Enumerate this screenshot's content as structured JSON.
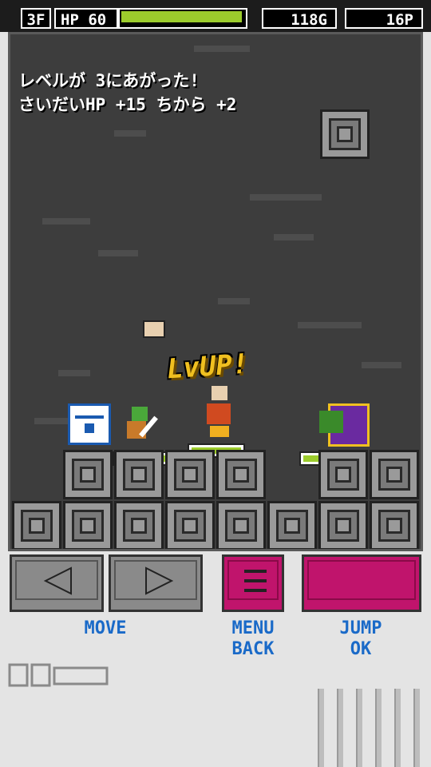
{
  "hud": {
    "floor": "3F",
    "hp_label": "HP",
    "hp_value": "60",
    "hp_fraction": 0.98,
    "gold": "118G",
    "points": "16P"
  },
  "message": {
    "line1": "レベルが 3にあがった!",
    "line2": "さいだいHP +15 ちから +2"
  },
  "effects": {
    "levelup_text": "LvUP!"
  },
  "controls": {
    "move_label": "MOVE",
    "menu_label_1": "MENU",
    "menu_label_2": "BACK",
    "jump_label_1": "JUMP",
    "jump_label_2": "OK"
  },
  "colors": {
    "hp_bar": "#9ccc2c",
    "button_magenta": "#c0146c",
    "label_blue": "#1a6ac8"
  },
  "icons": {
    "left": "left-triangle-icon",
    "right": "right-triangle-icon",
    "menu": "hamburger-menu-icon"
  }
}
